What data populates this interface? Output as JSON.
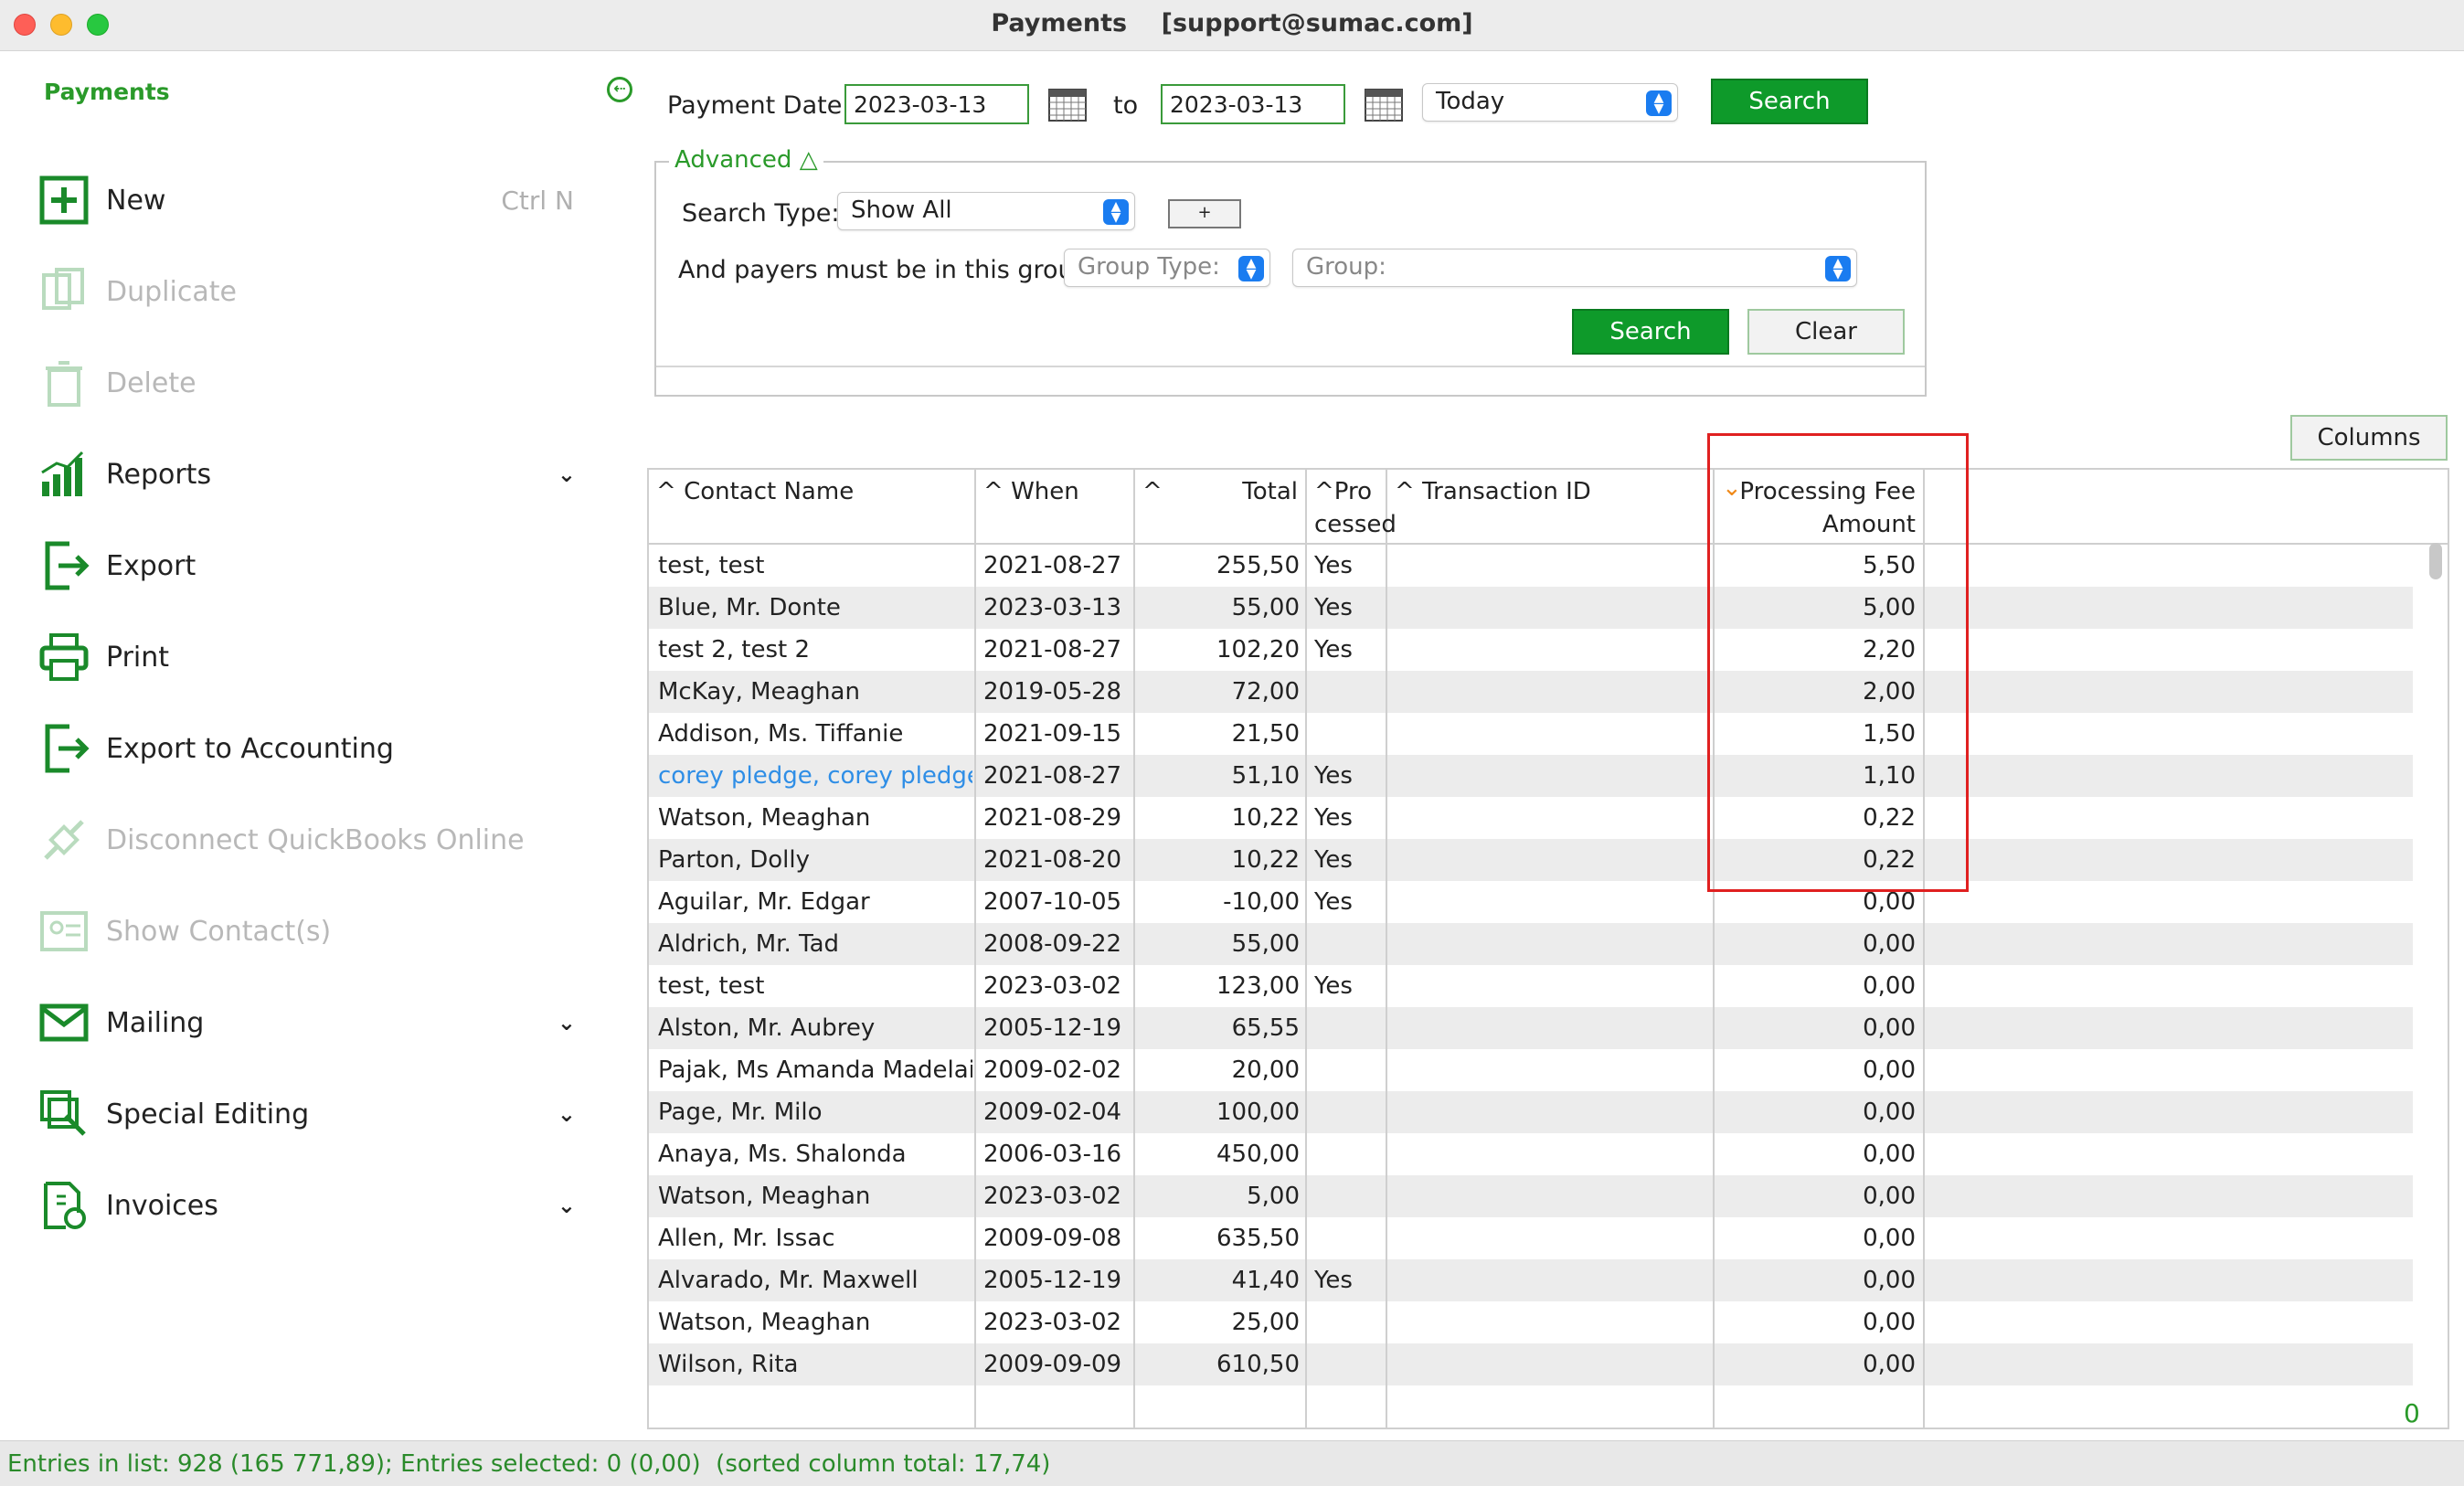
{
  "window": {
    "title": "Payments    [support@sumac.com]"
  },
  "sidebar": {
    "header": "Payments",
    "items": [
      {
        "label": "New",
        "shortcut": "Ctrl N",
        "icon": "plus-icon",
        "disabled": false
      },
      {
        "label": "Duplicate",
        "icon": "duplicate-icon",
        "disabled": true
      },
      {
        "label": "Delete",
        "icon": "trash-icon",
        "disabled": true
      },
      {
        "label": "Reports",
        "icon": "bar-chart-icon",
        "disabled": false,
        "chevron": "⌄"
      },
      {
        "label": "Export",
        "icon": "export-icon",
        "disabled": false
      },
      {
        "label": "Print",
        "icon": "printer-icon",
        "disabled": false
      },
      {
        "label": "Export to Accounting",
        "icon": "export-icon",
        "disabled": false
      },
      {
        "label": "Disconnect QuickBooks Online",
        "icon": "disconnect-icon",
        "disabled": true
      },
      {
        "label": "Show Contact(s)",
        "icon": "contacts-icon",
        "disabled": true
      },
      {
        "label": "Mailing",
        "icon": "envelope-icon",
        "disabled": false,
        "chevron": "⌄"
      },
      {
        "label": "Special Editing",
        "icon": "special-edit-icon",
        "disabled": false,
        "chevron": "⌄"
      },
      {
        "label": "Invoices",
        "icon": "invoice-icon",
        "disabled": false,
        "chevron": "⌄"
      }
    ]
  },
  "search": {
    "payment_date_label": "Payment Date",
    "date_from": "2023-03-13",
    "to_label": "to",
    "date_to": "2023-03-13",
    "range": "Today",
    "search_label": "Search"
  },
  "advanced": {
    "title": "Advanced △",
    "search_type_label": "Search Type:",
    "search_type_value": "Show All",
    "add_label": "+",
    "group_label": "And payers must be in this group:",
    "group_type_placeholder": "Group Type:",
    "group_placeholder": "Group:",
    "search_label": "Search",
    "clear_label": "Clear"
  },
  "columns_label": "Columns",
  "table": {
    "headers": {
      "contact": "Contact Name",
      "when": "When",
      "total": "Total",
      "processed_1": "Pro",
      "processed_2": "cessed",
      "transaction": "Transaction ID",
      "fee_1": "Processing Fee",
      "fee_2": "Amount"
    },
    "sort_up": "^",
    "sort_down": "⌄",
    "rows": [
      {
        "contact": "test, test",
        "when": "2021-08-27",
        "total": "255,50",
        "processed": "Yes",
        "fee": "5,50"
      },
      {
        "contact": "Blue, Mr. Donte",
        "when": "2023-03-13",
        "total": "55,00",
        "processed": "Yes",
        "fee": "5,00"
      },
      {
        "contact": "test 2, test 2",
        "when": "2021-08-27",
        "total": "102,20",
        "processed": "Yes",
        "fee": "2,20"
      },
      {
        "contact": "McKay, Meaghan",
        "when": "2019-05-28",
        "total": "72,00",
        "processed": "",
        "fee": "2,00"
      },
      {
        "contact": "Addison, Ms. Tiffanie",
        "when": "2021-09-15",
        "total": "21,50",
        "processed": "",
        "fee": "1,50"
      },
      {
        "contact": "corey pledge, corey pledge",
        "when": "2021-08-27",
        "total": "51,10",
        "processed": "Yes",
        "fee": "1,10",
        "link": true
      },
      {
        "contact": "Watson, Meaghan",
        "when": "2021-08-29",
        "total": "10,22",
        "processed": "Yes",
        "fee": "0,22"
      },
      {
        "contact": "Parton, Dolly",
        "when": "2021-08-20",
        "total": "10,22",
        "processed": "Yes",
        "fee": "0,22"
      },
      {
        "contact": "Aguilar, Mr. Edgar",
        "when": "2007-10-05",
        "total": "-10,00",
        "processed": "Yes",
        "fee": "0,00"
      },
      {
        "contact": "Aldrich, Mr. Tad",
        "when": "2008-09-22",
        "total": "55,00",
        "processed": "",
        "fee": "0,00"
      },
      {
        "contact": "test, test",
        "when": "2023-03-02",
        "total": "123,00",
        "processed": "Yes",
        "fee": "0,00"
      },
      {
        "contact": "Alston, Mr. Aubrey",
        "when": "2005-12-19",
        "total": "65,55",
        "processed": "",
        "fee": "0,00"
      },
      {
        "contact": "Pajak, Ms Amanda Madelaine",
        "when": "2009-02-02",
        "total": "20,00",
        "processed": "",
        "fee": "0,00"
      },
      {
        "contact": "Page, Mr. Milo",
        "when": "2009-02-04",
        "total": "100,00",
        "processed": "",
        "fee": "0,00"
      },
      {
        "contact": "Anaya, Ms. Shalonda",
        "when": "2006-03-16",
        "total": "450,00",
        "processed": "",
        "fee": "0,00"
      },
      {
        "contact": "Watson, Meaghan",
        "when": "2023-03-02",
        "total": "5,00",
        "processed": "",
        "fee": "0,00"
      },
      {
        "contact": "Allen, Mr. Issac",
        "when": "2009-09-08",
        "total": "635,50",
        "processed": "",
        "fee": "0,00"
      },
      {
        "contact": "Alvarado, Mr. Maxwell",
        "when": "2005-12-19",
        "total": "41,40",
        "processed": "Yes",
        "fee": "0,00"
      },
      {
        "contact": "Watson, Meaghan",
        "when": "2023-03-02",
        "total": "25,00",
        "processed": "",
        "fee": "0,00"
      },
      {
        "contact": "Wilson, Rita",
        "when": "2009-09-09",
        "total": "610,50",
        "processed": "",
        "fee": "0,00"
      }
    ]
  },
  "bottom_count": "0",
  "status": "Entries in list: 928 (165 771,89); Entries selected: 0 (0,00)  (sorted column total: 17,74)"
}
